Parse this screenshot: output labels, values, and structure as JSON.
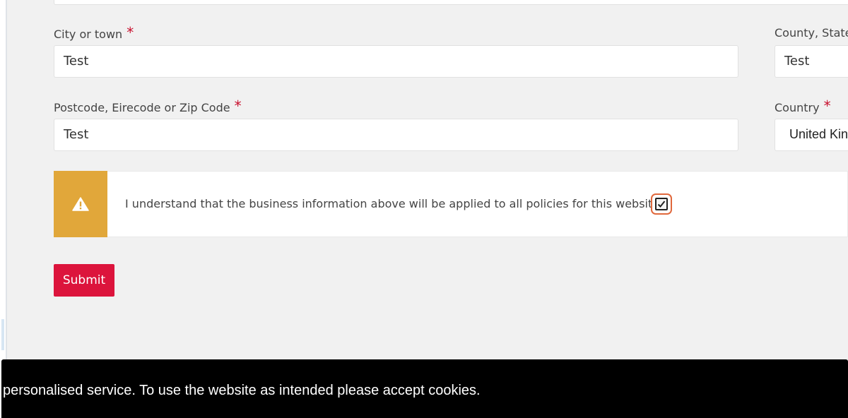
{
  "form": {
    "city": {
      "label": "City or town",
      "required_marker": "*",
      "value": "Test"
    },
    "county": {
      "label": "County, State",
      "value": "Test"
    },
    "postcode": {
      "label": "Postcode, Eirecode or Zip Code",
      "required_marker": "*",
      "value": "Test"
    },
    "country": {
      "label": "Country",
      "required_marker": "*",
      "selected": "United Kingdom"
    },
    "notice": {
      "icon": "warning-icon",
      "text": "I understand that the business information above will be applied to all policies for this website.",
      "checked": true
    },
    "submit_label": "Submit"
  },
  "cookie_banner": {
    "text": "personalised service. To use the website as intended please accept cookies."
  },
  "colors": {
    "accent_red": "#dc143c",
    "warning": "#e1a73a",
    "focus_ring": "#e0683c",
    "background": "#f1f1f1",
    "banner": "#000000"
  }
}
